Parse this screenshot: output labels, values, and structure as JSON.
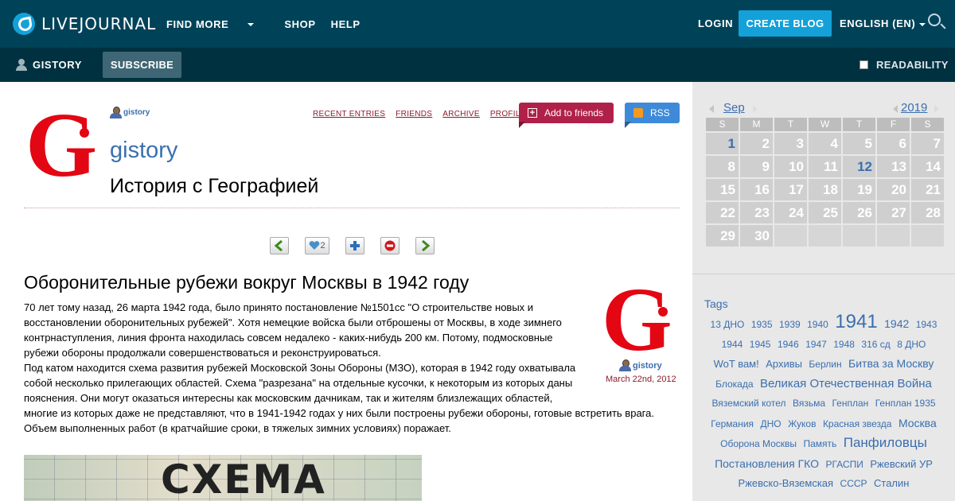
{
  "topbar": {
    "logo_text": "LIVEJOURNAL",
    "nav": [
      "FIND MORE",
      "SHOP",
      "HELP"
    ],
    "login": "LOGIN",
    "create_blog": "CREATE BLOG",
    "language": "ENGLISH (EN)"
  },
  "subbar": {
    "username": "GISTORY",
    "subscribe": "SUBSCRIBE",
    "readability": "READABILITY"
  },
  "journal": {
    "logo_letter": "G",
    "user_link": "gistory",
    "name": "gistory",
    "subtitle": "История с Географией",
    "links": [
      "RECENT ENTRIES",
      "FRIENDS",
      "ARCHIVE",
      "PROFILE"
    ],
    "add_friends": "Add to friends",
    "rss": "RSS",
    "like_count": "2"
  },
  "post": {
    "title": "Оборонительные рубежи вокруг Москвы в 1942 году",
    "para1": "70 лет тому назад, 26 марта 1942 года, было принято постановление №1501сс \"О строительстве новых и восстановлении оборонительных рубежей\". Хотя немецкие войска были отброшены от Москвы, в ходе зимнего контрнаступления, линия фронта находилась совсем недалеко - каких-нибудь 200 км. Потому, подмосковные рубежи обороны продолжали совершенствоваться и реконструироваться.",
    "para2a": "Под катом находится схема развития рубежей Московской Зоны Обороны (МЗО), которая в 1942 году охватывала собой несколько прилегающих областей. Схема \"разрезана\" на отдельные кусочки, к некоторым из которых даны пояснения. Они могут оказаться интересны как московским дачникам, так и жителям близлежащих областей,",
    "para2b": "многие из которых даже не представляют, что в 1941-1942 годах у них были построены рубежи обороны, готовые встретить врага. Объем выполненных работ (в кратчайшие сроки, в тяжелых зимних условиях) поражает.",
    "author": "gistory",
    "date": "March 22nd, 2012",
    "map_title": "СХЕМА"
  },
  "calendar": {
    "month": "Sep",
    "year": "2019",
    "weekdays": [
      "S",
      "M",
      "T",
      "W",
      "T",
      "F",
      "S"
    ],
    "weeks": [
      [
        "1",
        "2",
        "3",
        "4",
        "5",
        "6",
        "7"
      ],
      [
        "8",
        "9",
        "10",
        "11",
        "12",
        "13",
        "14"
      ],
      [
        "15",
        "16",
        "17",
        "18",
        "19",
        "20",
        "21"
      ],
      [
        "22",
        "23",
        "24",
        "25",
        "26",
        "27",
        "28"
      ],
      [
        "29",
        "30",
        "",
        "",
        "",
        "",
        ""
      ]
    ],
    "linked_days": [
      "1",
      "12"
    ]
  },
  "tags": {
    "title": "Tags",
    "items": [
      {
        "t": "13 ДНО",
        "s": 12
      },
      {
        "t": "1935",
        "s": 12
      },
      {
        "t": "1939",
        "s": 12
      },
      {
        "t": "1940",
        "s": 12
      },
      {
        "t": "1941",
        "s": 24
      },
      {
        "t": "1942",
        "s": 14
      },
      {
        "t": "1943",
        "s": 12
      },
      {
        "t": "1944",
        "s": 12
      },
      {
        "t": "1945",
        "s": 12
      },
      {
        "t": "1946",
        "s": 12
      },
      {
        "t": "1947",
        "s": 12
      },
      {
        "t": "1948",
        "s": 12
      },
      {
        "t": "316 сд",
        "s": 12
      },
      {
        "t": "8 ДНО",
        "s": 12
      },
      {
        "t": "WoT вам!",
        "s": 13
      },
      {
        "t": "Архивы",
        "s": 13
      },
      {
        "t": "Берлин",
        "s": 12
      },
      {
        "t": "Битва за Москву",
        "s": 14
      },
      {
        "t": "Блокада",
        "s": 12
      },
      {
        "t": "Великая Отечественная Война",
        "s": 15
      },
      {
        "t": "Вяземский котел",
        "s": 12
      },
      {
        "t": "Вязьма",
        "s": 12
      },
      {
        "t": "Генплан",
        "s": 12
      },
      {
        "t": "Генплан 1935",
        "s": 12
      },
      {
        "t": "Германия",
        "s": 12
      },
      {
        "t": "ДНО",
        "s": 12
      },
      {
        "t": "Жуков",
        "s": 12
      },
      {
        "t": "Красная звезда",
        "s": 12
      },
      {
        "t": "Москва",
        "s": 14
      },
      {
        "t": "Оборона Москвы",
        "s": 12
      },
      {
        "t": "Память",
        "s": 12
      },
      {
        "t": "Панфиловцы",
        "s": 17
      },
      {
        "t": "Постановления ГКО",
        "s": 14
      },
      {
        "t": "РГАСПИ",
        "s": 12
      },
      {
        "t": "Ржевский УР",
        "s": 13
      },
      {
        "t": "Ржевско-Вяземская",
        "s": 13
      },
      {
        "t": "СССР",
        "s": 12
      },
      {
        "t": "Сталин",
        "s": 13
      }
    ]
  },
  "colors": {
    "topbar": "#004359",
    "subbar": "#003140",
    "accent": "#14a1d9",
    "link": "#3a6fb0",
    "add_friends": "#b0214a",
    "rss": "#3f8ad8"
  }
}
